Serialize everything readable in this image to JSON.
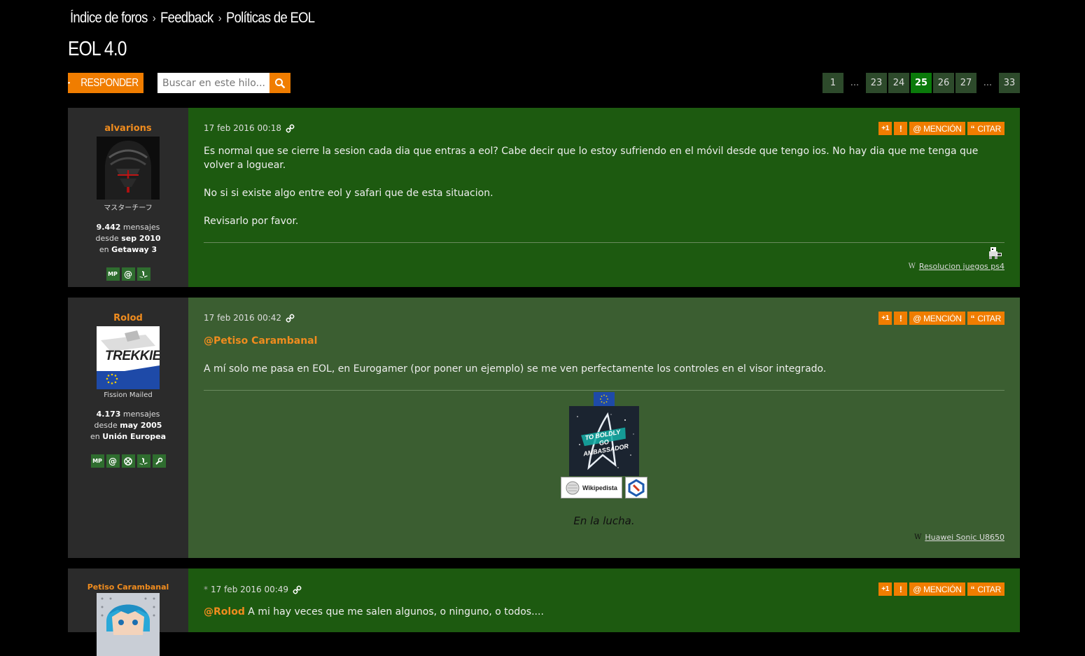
{
  "breadcrumb": {
    "items": [
      "Índice de foros",
      "Feedback",
      "Políticas de EOL"
    ],
    "separator": "›"
  },
  "thread_title": "EOL 4.0",
  "toolbar": {
    "reply_label": "RESPONDER",
    "search_placeholder": "Buscar en este hilo..."
  },
  "pagination": {
    "p1": "1",
    "dots1": "...",
    "p23": "23",
    "p24": "24",
    "p25": "25",
    "p26": "26",
    "p27": "27",
    "dots2": "...",
    "p33": "33",
    "current": "25"
  },
  "actions": {
    "plus_one": "+1",
    "report": "!",
    "mention": "@ MENCIÓN",
    "quote": "CITAR"
  },
  "posts": [
    {
      "username": "alvarions",
      "rank": "マスターチーフ",
      "messages_count": "9.442",
      "messages_word": "mensajes",
      "since_word": "desde",
      "since_date": "sep 2010",
      "location_word": "en",
      "location": "Getaway 3",
      "icons": [
        "MP",
        "@",
        "PS"
      ],
      "timestamp": "17 feb 2016 00:18",
      "paragraphs": [
        "Es normal que se cierre la sesion cada dia que entras a eol? Cabe decir que lo estoy sufriendo en el móvil desde que tengo ios. No hay dia que me tenga que volver a loguear.",
        "No si si existe algo entre eol y safari que de esta situacion.",
        "Revisarlo por favor."
      ],
      "signature_link": "Resolucion juegos ps4"
    },
    {
      "username": "Rolod",
      "avatar_text": "TREKKIE",
      "rank": "Fission Mailed",
      "messages_count": "4.173",
      "messages_word": "mensajes",
      "since_word": "desde",
      "since_date": "may 2005",
      "location_word": "en",
      "location": "Unión Europea",
      "icons": [
        "MP",
        "@",
        "XB",
        "PS",
        "ST"
      ],
      "timestamp": "17 feb 2016 00:42",
      "mention": "@Petiso Carambanal",
      "text": "A mí solo me pasa en EOL, en Eurogamer (por poner un ejemplo) se me ven perfectamente los controles en el visor integrado.",
      "signature_banner": "TO BOLDLY GO AMBASSADOR",
      "signature_badge": "Wikipedista",
      "signature_quote": "En la lucha.",
      "signature_device": "Huawei Sonic U8650"
    },
    {
      "username": "Petiso Carambanal",
      "edited_mark": "*",
      "timestamp": "17 feb 2016 00:49",
      "mention": "@Rolod",
      "text": "A mi hay veces que me salen algunos, o ninguno, o todos...."
    }
  ],
  "colors": {
    "accent": "#f07d00",
    "post_green": "#1d5a10",
    "post_alt": "#3b5e31",
    "sidebar": "#2b2b2b",
    "username": "#f08c1e"
  }
}
